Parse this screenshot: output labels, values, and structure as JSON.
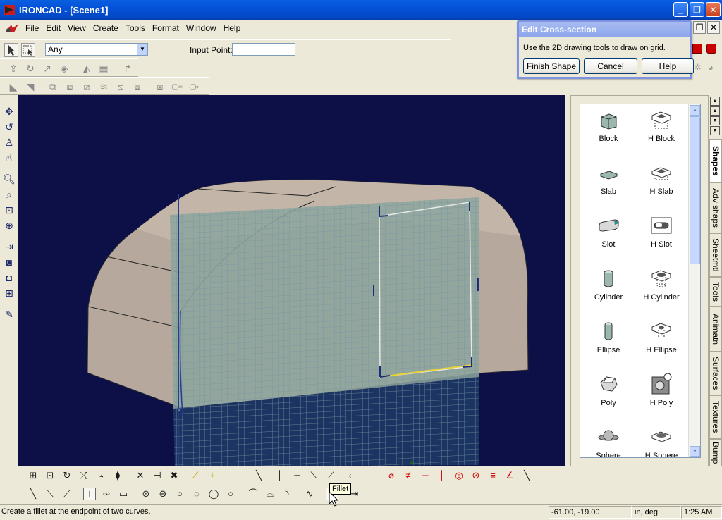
{
  "window": {
    "title": "IRONCAD - [Scene1]",
    "minimize": "_",
    "restore": "❐",
    "close": "✕"
  },
  "menu": {
    "items": [
      "File",
      "Edit",
      "View",
      "Create",
      "Tools",
      "Format",
      "Window",
      "Help"
    ]
  },
  "selection_bar": {
    "filter_value": "Any",
    "input_point_label": "Input Point:",
    "input_point_value": ""
  },
  "dialog": {
    "title": "Edit Cross-section",
    "message": "Use the 2D drawing tools to draw on grid.",
    "finish_label": "Finish Shape",
    "cancel_label": "Cancel",
    "help_label": "Help"
  },
  "catalog": {
    "items": [
      {
        "label": "Block",
        "icon": "block-icon"
      },
      {
        "label": "H Block",
        "icon": "h-block-icon"
      },
      {
        "label": "Slab",
        "icon": "slab-icon"
      },
      {
        "label": "H Slab",
        "icon": "h-slab-icon"
      },
      {
        "label": "Slot",
        "icon": "slot-icon"
      },
      {
        "label": "H Slot",
        "icon": "h-slot-icon"
      },
      {
        "label": "Cylinder",
        "icon": "cylinder-icon"
      },
      {
        "label": "H Cylinder",
        "icon": "h-cylinder-icon"
      },
      {
        "label": "Ellipse",
        "icon": "ellipse-icon"
      },
      {
        "label": "H Ellipse",
        "icon": "h-ellipse-icon"
      },
      {
        "label": "Poly",
        "icon": "poly-icon"
      },
      {
        "label": "H Poly",
        "icon": "h-poly-icon"
      },
      {
        "label": "Sphere",
        "icon": "sphere-icon"
      },
      {
        "label": "H Sphere",
        "icon": "h-sphere-icon"
      }
    ],
    "tabs": [
      "Shapes",
      "Adv shaps",
      "Sheetmtl",
      "Tools",
      "Animatn",
      "Surfaces",
      "Textures",
      "Bump"
    ]
  },
  "tooltip": "Fillet",
  "status": {
    "message": "Create a fillet at the endpoint of two curves.",
    "coordinates": "-61.00, -19.00",
    "units": "in, deg",
    "time": "1:25 AM"
  },
  "colors": {
    "viewport_bg": "#0c1046",
    "grid_line": "#7f9aa0",
    "model_face": "#b8aa9e",
    "titlebar": "#0451d8"
  }
}
